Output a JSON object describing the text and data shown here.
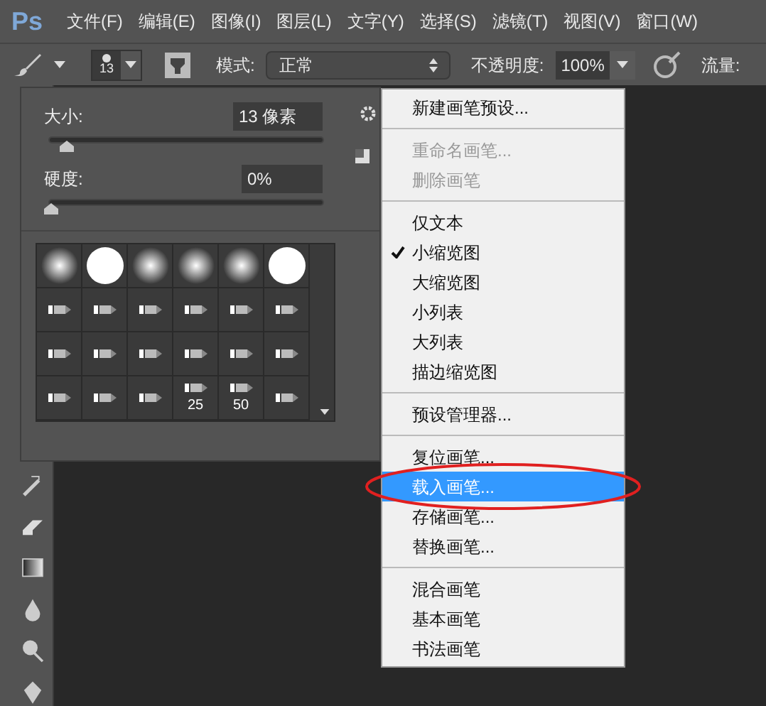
{
  "app_logo": "Ps",
  "menu_bar": [
    "文件(F)",
    "编辑(E)",
    "图像(I)",
    "图层(L)",
    "文字(Y)",
    "选择(S)",
    "滤镜(T)",
    "视图(V)",
    "窗口(W)"
  ],
  "options_bar": {
    "brush_size": "13",
    "mode_label": "模式:",
    "mode_value": "正常",
    "opacity_label": "不透明度:",
    "opacity_value": "100%",
    "flow_label": "流量:"
  },
  "brush_panel": {
    "size_label": "大小:",
    "size_value": "13 像素",
    "size_slider": {
      "level": 0.06
    },
    "hardness_label": "硬度:",
    "hardness_value": "0%",
    "hardness_slider": {
      "level": 0
    },
    "brushes": [
      {
        "kind": "soft"
      },
      {
        "kind": "hard"
      },
      {
        "kind": "soft"
      },
      {
        "kind": "soft"
      },
      {
        "kind": "soft"
      },
      {
        "kind": "hard"
      },
      {
        "kind": "stroke"
      },
      {
        "kind": "stroke"
      },
      {
        "kind": "stroke"
      },
      {
        "kind": "stroke"
      },
      {
        "kind": "stroke"
      },
      {
        "kind": "stroke"
      },
      {
        "kind": "stroke"
      },
      {
        "kind": "stroke"
      },
      {
        "kind": "stroke"
      },
      {
        "kind": "stroke"
      },
      {
        "kind": "stroke"
      },
      {
        "kind": "stroke"
      },
      {
        "kind": "stroke"
      },
      {
        "kind": "stroke"
      },
      {
        "kind": "stroke"
      },
      {
        "kind": "stroke",
        "label": "25"
      },
      {
        "kind": "stroke",
        "label": "50"
      },
      {
        "kind": "stroke"
      }
    ]
  },
  "context_menu": [
    [
      {
        "label": "新建画笔预设...",
        "disabled": false,
        "checked": false,
        "selected": false,
        "circled": false
      }
    ],
    [
      {
        "label": "重命名画笔...",
        "disabled": true,
        "checked": false,
        "selected": false,
        "circled": false
      },
      {
        "label": "删除画笔",
        "disabled": true,
        "checked": false,
        "selected": false,
        "circled": false
      }
    ],
    [
      {
        "label": "仅文本",
        "disabled": false,
        "checked": false,
        "selected": false,
        "circled": false
      },
      {
        "label": "小缩览图",
        "disabled": false,
        "checked": true,
        "selected": false,
        "circled": false
      },
      {
        "label": "大缩览图",
        "disabled": false,
        "checked": false,
        "selected": false,
        "circled": false
      },
      {
        "label": "小列表",
        "disabled": false,
        "checked": false,
        "selected": false,
        "circled": false
      },
      {
        "label": "大列表",
        "disabled": false,
        "checked": false,
        "selected": false,
        "circled": false
      },
      {
        "label": "描边缩览图",
        "disabled": false,
        "checked": false,
        "selected": false,
        "circled": false
      }
    ],
    [
      {
        "label": "预设管理器...",
        "disabled": false,
        "checked": false,
        "selected": false,
        "circled": false
      }
    ],
    [
      {
        "label": "复位画笔...",
        "disabled": false,
        "checked": false,
        "selected": false,
        "circled": false
      },
      {
        "label": "载入画笔...",
        "disabled": false,
        "checked": false,
        "selected": true,
        "circled": true
      },
      {
        "label": "存储画笔...",
        "disabled": false,
        "checked": false,
        "selected": false,
        "circled": false
      },
      {
        "label": "替换画笔...",
        "disabled": false,
        "checked": false,
        "selected": false,
        "circled": false
      }
    ],
    [
      {
        "label": "混合画笔",
        "disabled": false,
        "checked": false,
        "selected": false,
        "circled": false
      },
      {
        "label": "基本画笔",
        "disabled": false,
        "checked": false,
        "selected": false,
        "circled": false
      },
      {
        "label": "书法画笔",
        "disabled": false,
        "checked": false,
        "selected": false,
        "circled": false
      }
    ]
  ]
}
